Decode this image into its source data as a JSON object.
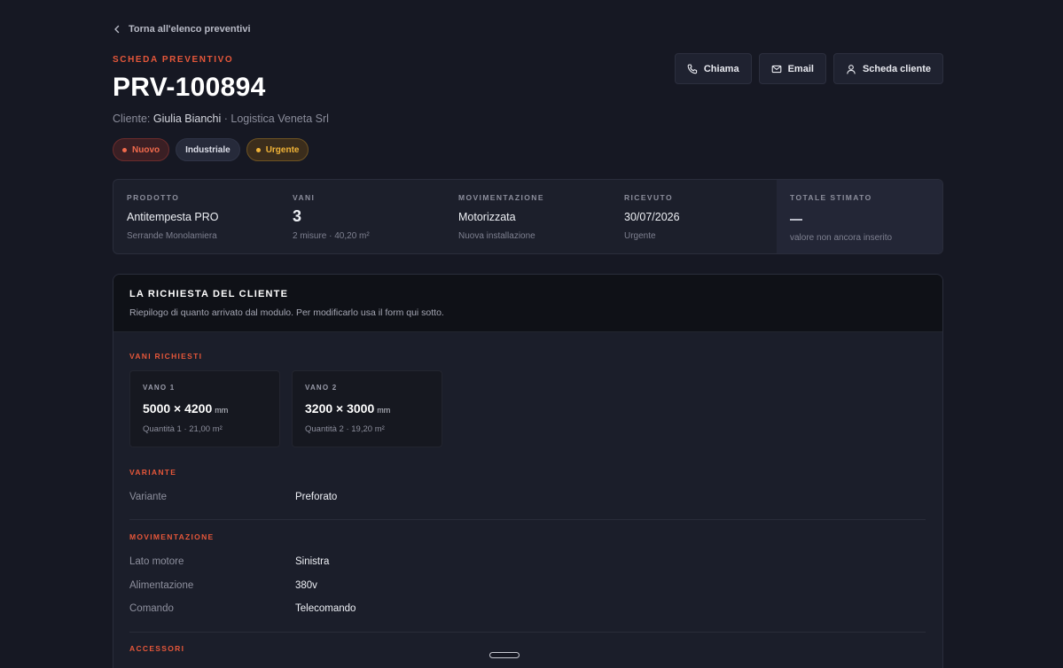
{
  "nav": {
    "back_label": "Torna all'elenco preventivi"
  },
  "header": {
    "eyebrow": "SCHEDA PREVENTIVO",
    "title": "PRV-100894",
    "client_prefix": "Cliente: ",
    "client_name": "Giulia Bianchi",
    "client_company": " · Logistica Veneta Srl",
    "badges": [
      {
        "label": "Nuovo",
        "color": "#f06a4c"
      },
      {
        "label": "Industriale"
      },
      {
        "label": "Urgente",
        "color": "#f0b338"
      }
    ]
  },
  "actions": {
    "call_label": "Chiama",
    "email_label": "Email",
    "client_card_label": "Scheda cliente"
  },
  "summary": {
    "prodotto": {
      "label": "PRODOTTO",
      "value": "Antitempesta PRO",
      "sub": "Serrande Monolamiera"
    },
    "vani": {
      "label": "VANI",
      "value": "3",
      "sub": "2 misure · 40,20 m²"
    },
    "movimentazione": {
      "label": "MOVIMENTAZIONE",
      "value": "Motorizzata",
      "sub": "Nuova installazione"
    },
    "ricevuto": {
      "label": "RICEVUTO",
      "value": "30/07/2026",
      "sub": "Urgente"
    },
    "totale": {
      "label": "TOTALE STIMATO",
      "sub": "valore non ancora inserito"
    }
  },
  "request": {
    "title": "LA RICHIESTA DEL CLIENTE",
    "description": "Riepilogo di quanto arrivato dal modulo. Per modificarlo usa il form qui sotto.",
    "vani_title": "VANI RICHIESTI",
    "vani": [
      {
        "label": "VANO 1",
        "dimensions": "5000 × 4200",
        "unit": "mm",
        "sub": "Quantità 1 · 21,00 m²"
      },
      {
        "label": "VANO 2",
        "dimensions": "3200 × 3000",
        "unit": "mm",
        "sub": "Quantità 2 · 19,20 m²"
      }
    ],
    "variante_title": "VARIANTE",
    "variante": {
      "key": "Variante",
      "value": "Preforato"
    },
    "movimentazione_title": "MOVIMENTAZIONE",
    "movimentazione": [
      {
        "key": "Lato motore",
        "value": "Sinistra"
      },
      {
        "key": "Alimentazione",
        "value": "380v"
      },
      {
        "key": "Comando",
        "value": "Telecomando"
      }
    ],
    "accessori_title": "ACCESSORI"
  },
  "colors": {
    "accent": "#e6573a",
    "background": "#161823",
    "urgent": "#f0b338"
  }
}
